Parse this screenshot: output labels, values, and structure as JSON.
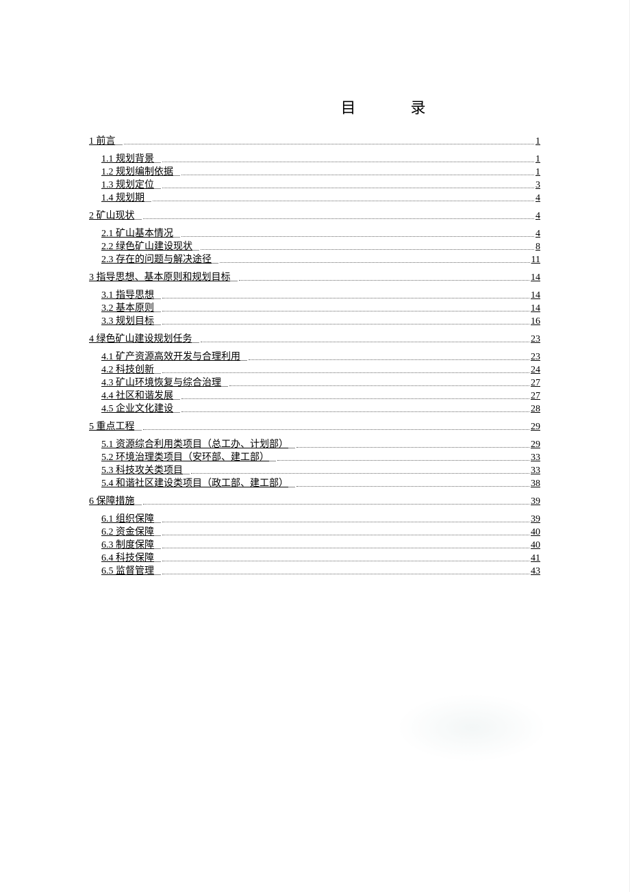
{
  "title": "目录",
  "watermark": "",
  "toc": [
    {
      "level": 1,
      "label": "1 前言",
      "page": "1"
    },
    {
      "level": 2,
      "label": "1.1 规划背景",
      "page": "1"
    },
    {
      "level": 2,
      "label": "1.2 规划编制依据",
      "page": "1"
    },
    {
      "level": 2,
      "label": "1.3 规划定位",
      "page": "3"
    },
    {
      "level": 2,
      "label": "1.4 规划期",
      "page": "4"
    },
    {
      "level": 1,
      "label": "2 矿山现状",
      "page": "4"
    },
    {
      "level": 2,
      "label": "2.1 矿山基本情况",
      "page": "4"
    },
    {
      "level": 2,
      "label": "2.2 绿色矿山建设现状",
      "page": "8"
    },
    {
      "level": 2,
      "label": "2.3 存在的问题与解决途径",
      "page": "11"
    },
    {
      "level": 1,
      "label": "3 指导思想、基本原则和规划目标",
      "page": "14"
    },
    {
      "level": 2,
      "label": "3.1 指导思想",
      "page": "14"
    },
    {
      "level": 2,
      "label": "3.2 基本原则",
      "page": "14"
    },
    {
      "level": 2,
      "label": "3.3 规划目标",
      "page": "16"
    },
    {
      "level": 1,
      "label": "4 绿色矿山建设规划任务",
      "page": "23"
    },
    {
      "level": 2,
      "label": "4.1 矿产资源高效开发与合理利用",
      "page": "23"
    },
    {
      "level": 2,
      "label": "4.2 科技创新",
      "page": "24"
    },
    {
      "level": 2,
      "label": "4.3 矿山环境恢复与综合治理",
      "page": "27"
    },
    {
      "level": 2,
      "label": "4.4 社区和谐发展",
      "page": "27"
    },
    {
      "level": 2,
      "label": "4.5 企业文化建设",
      "page": "28"
    },
    {
      "level": 1,
      "label": "5 重点工程",
      "page": "29"
    },
    {
      "level": 2,
      "label": "5.1 资源综合利用类项目（总工办、计划部）",
      "page": "29"
    },
    {
      "level": 2,
      "label": "5.2 环境治理类项目（安环部、建工部）",
      "page": "33"
    },
    {
      "level": 2,
      "label": "5.3  科技攻关类项目",
      "page": "33"
    },
    {
      "level": 2,
      "label": "5.4 和谐社区建设类项目（政工部、建工部）",
      "page": "38"
    },
    {
      "level": 1,
      "label": "6 保障措施",
      "page": "39"
    },
    {
      "level": 2,
      "label": "6.1 组织保障",
      "page": "39"
    },
    {
      "level": 2,
      "label": "6.2 资金保障",
      "page": "40"
    },
    {
      "level": 2,
      "label": "6.3 制度保障",
      "page": "40"
    },
    {
      "level": 2,
      "label": "6.4 科技保障",
      "page": "41"
    },
    {
      "level": 2,
      "label": "6.5 监督管理",
      "page": "43"
    }
  ]
}
